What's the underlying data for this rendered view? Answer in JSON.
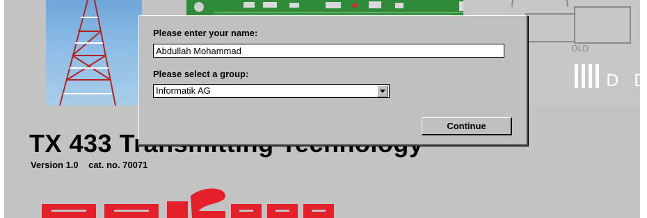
{
  "dialog": {
    "name_label": "Please enter your name:",
    "name_value": "Abdullah Mohammad",
    "group_label": "Please select a group:",
    "group_selected": "Informatik AG",
    "continue_label": "Continue"
  },
  "app": {
    "title": "TX 433 Transmitting Technology",
    "version_line": "Version 1.0    cat. no. 70071"
  },
  "colors": {
    "window_background": "#c3c3c3",
    "dialog_background": "#c0c0c0",
    "brand_red": "#e4202a"
  },
  "icons": [
    "chevron-down-icon"
  ]
}
